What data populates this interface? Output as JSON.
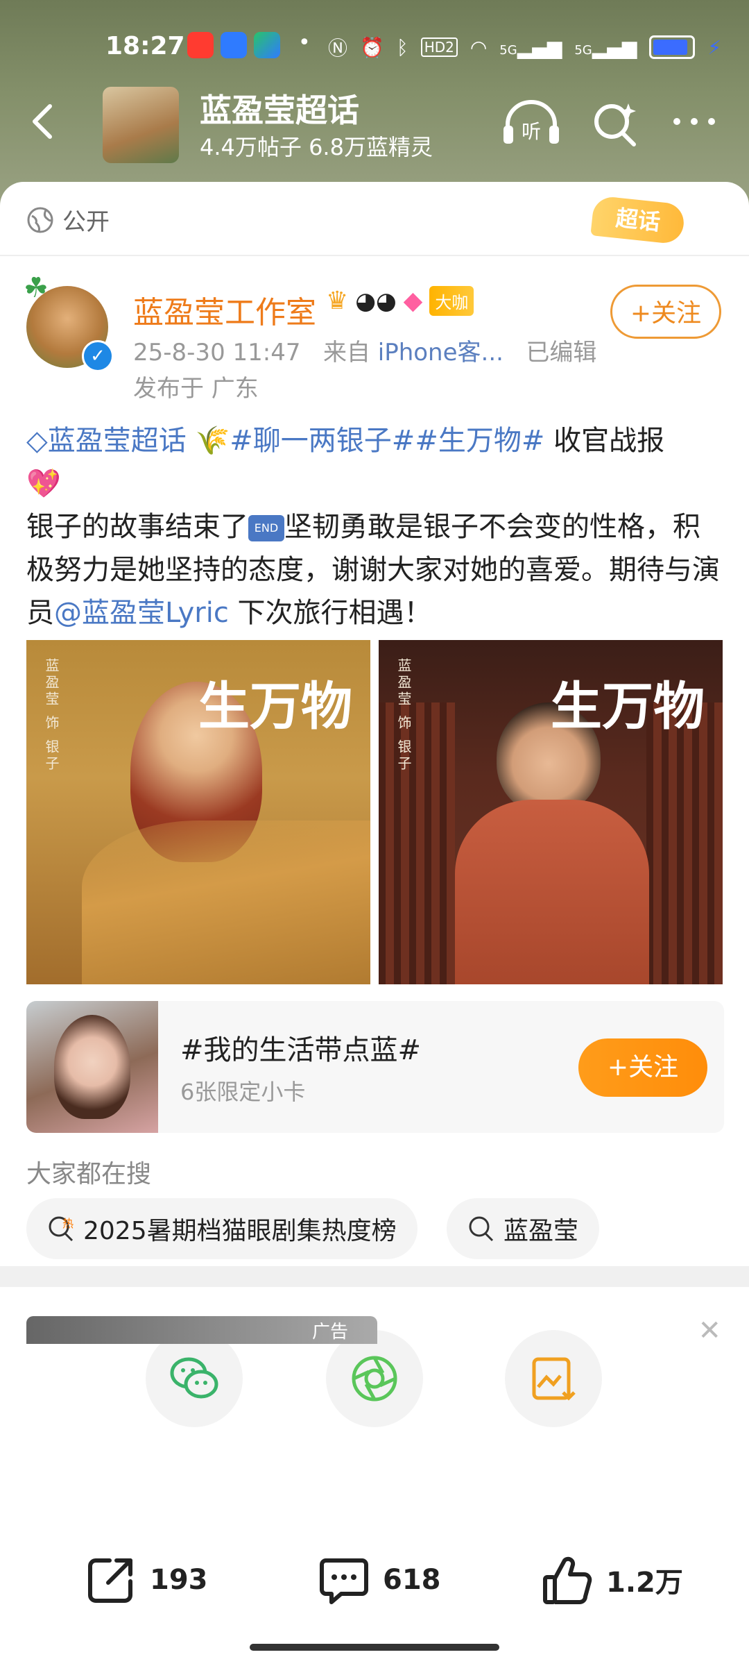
{
  "status_bar": {
    "time": "18:27",
    "hd": "HD2",
    "network": [
      "5G",
      "5G"
    ]
  },
  "topbar": {
    "title": "蓝盈莹超话",
    "subtitle": "4.4万帖子 6.8万蓝精灵",
    "listen_label": "听"
  },
  "post": {
    "visibility": "公开",
    "badge": "超话",
    "author": "蓝盈莹工作室",
    "author_badge": "大咖",
    "date": "25-8-30 11:47",
    "source_prefix": "来自",
    "source": "iPhone客...",
    "edited": "已编辑",
    "location": "发布于 广东",
    "follow": "+关注",
    "text": {
      "supertopic": "蓝盈莹超话",
      "tags": "#聊一两银子##生万物#",
      "line1_rest": " 收官战报",
      "body1": "银子的故事结束了",
      "end_label": "END",
      "body2": "坚韧勇敢是银子不会变的性格，积极努力是她坚持的态度，谢谢大家对她的喜爱。期待与演员",
      "mention": "@蓝盈莹Lyric",
      "body3": " 下次旅行相遇！"
    },
    "images": [
      {
        "vertical_text": "蓝盈莹 饰 银子",
        "logo": "生万物"
      },
      {
        "vertical_text": "蓝盈莹 饰 银子",
        "logo": "生万物"
      }
    ]
  },
  "topic_card": {
    "title": "#我的生活带点蓝#",
    "subtitle": "6张限定小卡",
    "follow": "+关注"
  },
  "searches": {
    "heading": "大家都在搜",
    "items": [
      {
        "label": "2025暑期档猫眼剧集热度榜",
        "icon": "hot-search-icon"
      },
      {
        "label": "蓝盈莹",
        "icon": "search-icon"
      }
    ]
  },
  "ad": {
    "label": "广告"
  },
  "actions": {
    "repost": "193",
    "comment": "618",
    "like": "1.2万"
  },
  "colors": {
    "orange": "#ee7b1a",
    "blue_link": "#4a78c4",
    "header": "#7b8660"
  }
}
